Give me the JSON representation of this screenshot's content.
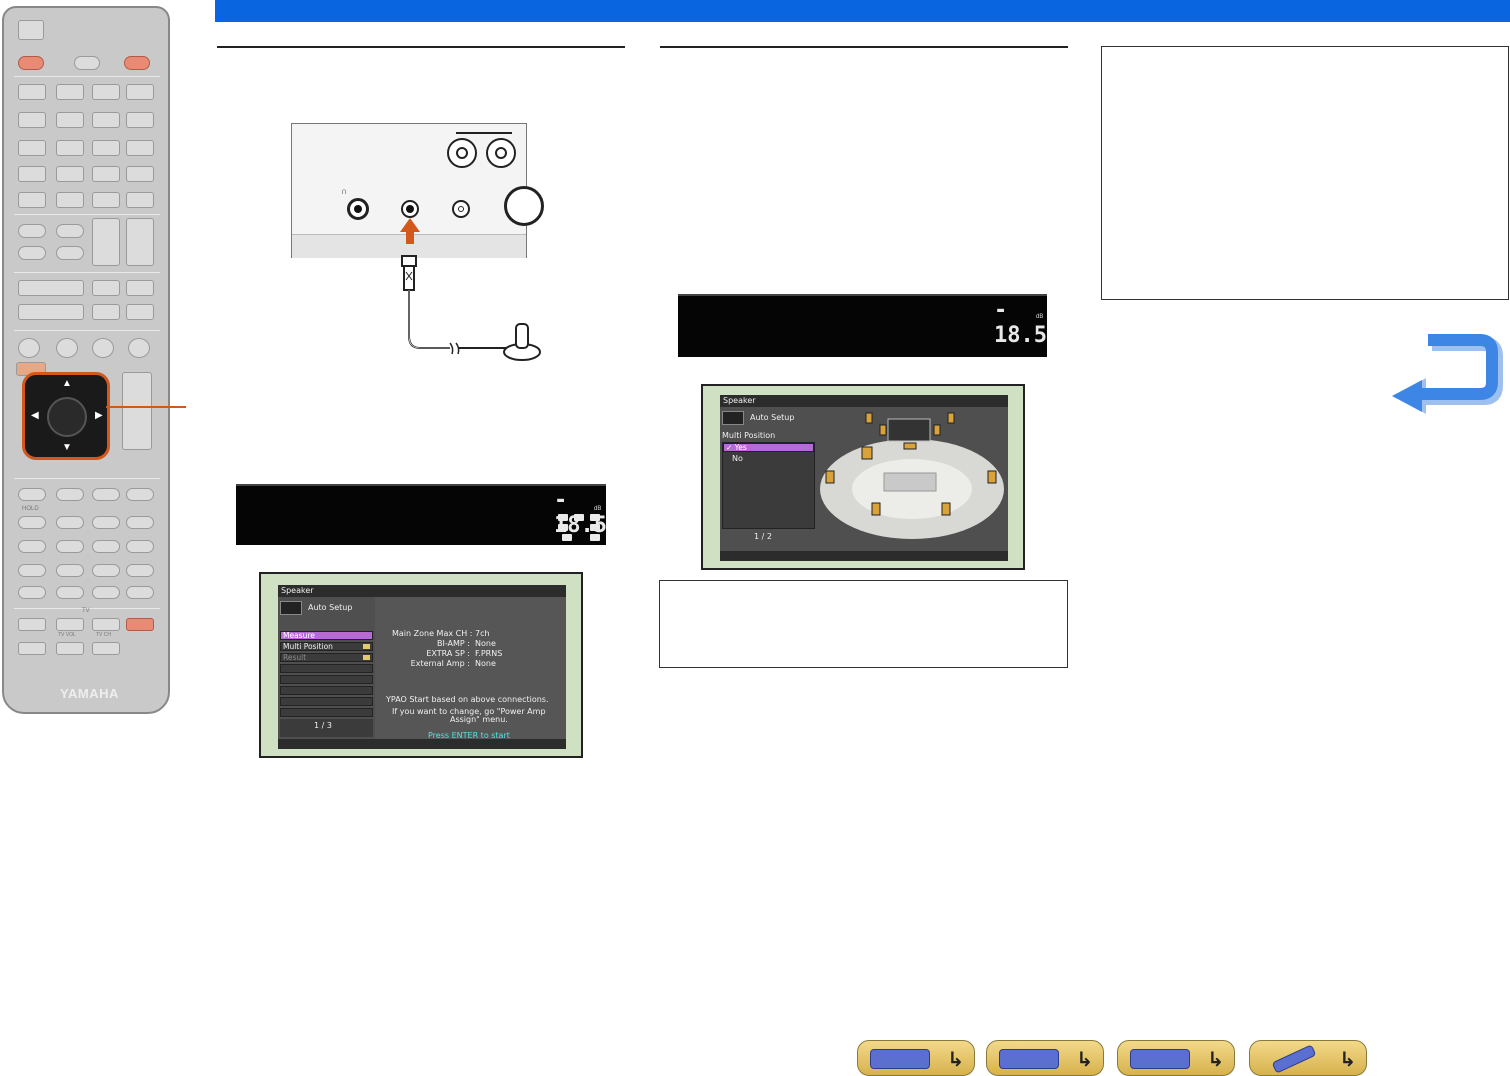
{
  "colors": {
    "header_bar": "#0a66e0",
    "accent_orange": "#d3581c",
    "menu_highlight": "#b76ad6",
    "osd_prompt": "#4de3e3"
  },
  "remote": {
    "brand": "YAMAHA",
    "labels": {
      "hold": "HOLD",
      "tv": "TV",
      "tv_vol": "TV VOL",
      "tv_ch": "TV CH"
    }
  },
  "fl_display_1": {
    "volume": "- 18.5",
    "unit": "dB"
  },
  "fl_display_2": {
    "volume": "- 18.5",
    "unit": "dB"
  },
  "osd_auto_setup": {
    "header": "Speaker",
    "title": "Auto Setup",
    "menu": [
      {
        "label": "Measure",
        "state": "selected"
      },
      {
        "label": "Multi Position",
        "state": "folder"
      },
      {
        "label": "Result",
        "state": "disabled"
      }
    ],
    "page": "1 / 3",
    "settings": [
      {
        "label": "Main Zone Max CH :",
        "value": "7ch"
      },
      {
        "label": "BI-AMP :",
        "value": "None"
      },
      {
        "label": "EXTRA SP :",
        "value": "F.PRNS"
      },
      {
        "label": "External Amp :",
        "value": "None"
      }
    ],
    "message_1": "YPAO Start based on above connections.",
    "message_2": "If you want to change, go \"Power Amp",
    "message_3": "Assign\" menu.",
    "prompt": "Press ENTER to start"
  },
  "osd_multi_position": {
    "header": "Speaker",
    "title": "Auto Setup",
    "section": "Multi Position",
    "options": [
      {
        "label": "Yes",
        "state": "selected"
      },
      {
        "label": "No",
        "state": "normal"
      }
    ],
    "page": "1 / 2"
  },
  "nav_icons": [
    {
      "name": "front-panel-nav",
      "icon": "receiver-front-icon"
    },
    {
      "name": "rear-panel-nav",
      "icon": "receiver-rear-icon"
    },
    {
      "name": "display-nav",
      "icon": "display-panel-icon"
    },
    {
      "name": "remote-nav",
      "icon": "remote-control-icon"
    }
  ]
}
